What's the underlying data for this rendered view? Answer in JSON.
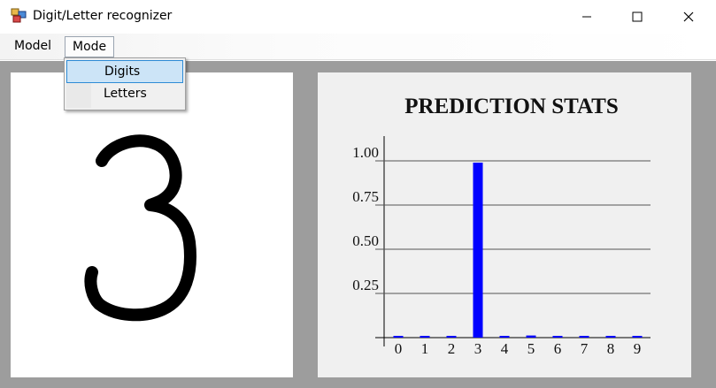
{
  "window": {
    "title": "Digit/Letter recognizer",
    "minimize_icon": "minimize-icon",
    "maximize_icon": "maximize-icon",
    "close_icon": "close-icon"
  },
  "menu": {
    "model_label": "Model",
    "mode_label": "Mode",
    "mode_dropdown": [
      "Digits",
      "Letters"
    ],
    "highlighted": "Digits"
  },
  "canvas": {
    "drawn_glyph": "3"
  },
  "colors": {
    "bar": "#0000ff",
    "panel": "#f0f0f0",
    "client": "#9d9d9d",
    "highlight": "#cce4f7"
  },
  "chart_data": {
    "type": "bar",
    "title": "PREDICTION STATS",
    "categories": [
      "0",
      "1",
      "2",
      "3",
      "4",
      "5",
      "6",
      "7",
      "8",
      "9"
    ],
    "values": [
      0.005,
      0.005,
      0.005,
      0.99,
      0.005,
      0.012,
      0.005,
      0.005,
      0.005,
      0.005
    ],
    "ylim": [
      0,
      1
    ],
    "yticks": [
      0.25,
      0.5,
      0.75,
      1.0
    ],
    "ytick_labels": [
      "0.25",
      "0.50",
      "0.75",
      "1.00"
    ],
    "grid": true
  }
}
